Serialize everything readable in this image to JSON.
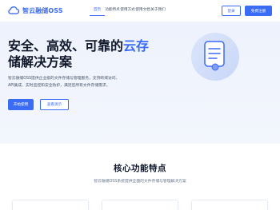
{
  "brand": {
    "name": "智云融储OSS",
    "accent_color": "#3b6cf6"
  },
  "nav": {
    "items": [
      {
        "label": "首页",
        "active": true
      },
      {
        "label": "功能特点",
        "active": false
      },
      {
        "label": "使用方式",
        "active": false
      },
      {
        "label": "使用文档",
        "active": false
      },
      {
        "label": "关于我们",
        "active": false
      }
    ],
    "login_label": "登录",
    "register_label": "免费注册"
  },
  "hero": {
    "title_part1": "安全、高效、可靠的",
    "title_accent": "云存",
    "title_part2": "储解决方案",
    "description_line1": "智云融储OSS提供企业级的文件存储与管理服务，支持跨域访问、",
    "description_line2": "API集成、实时监控和安全防护，满足您所有文件存储需求。",
    "start_label": "开始使用",
    "demo_label": "查看演示",
    "illustration_icon": "document-icon"
  },
  "features": {
    "title": "核心功能特点",
    "subtitle": "智云融储OSS系统提供全面的文件存储与管理解决方案"
  }
}
